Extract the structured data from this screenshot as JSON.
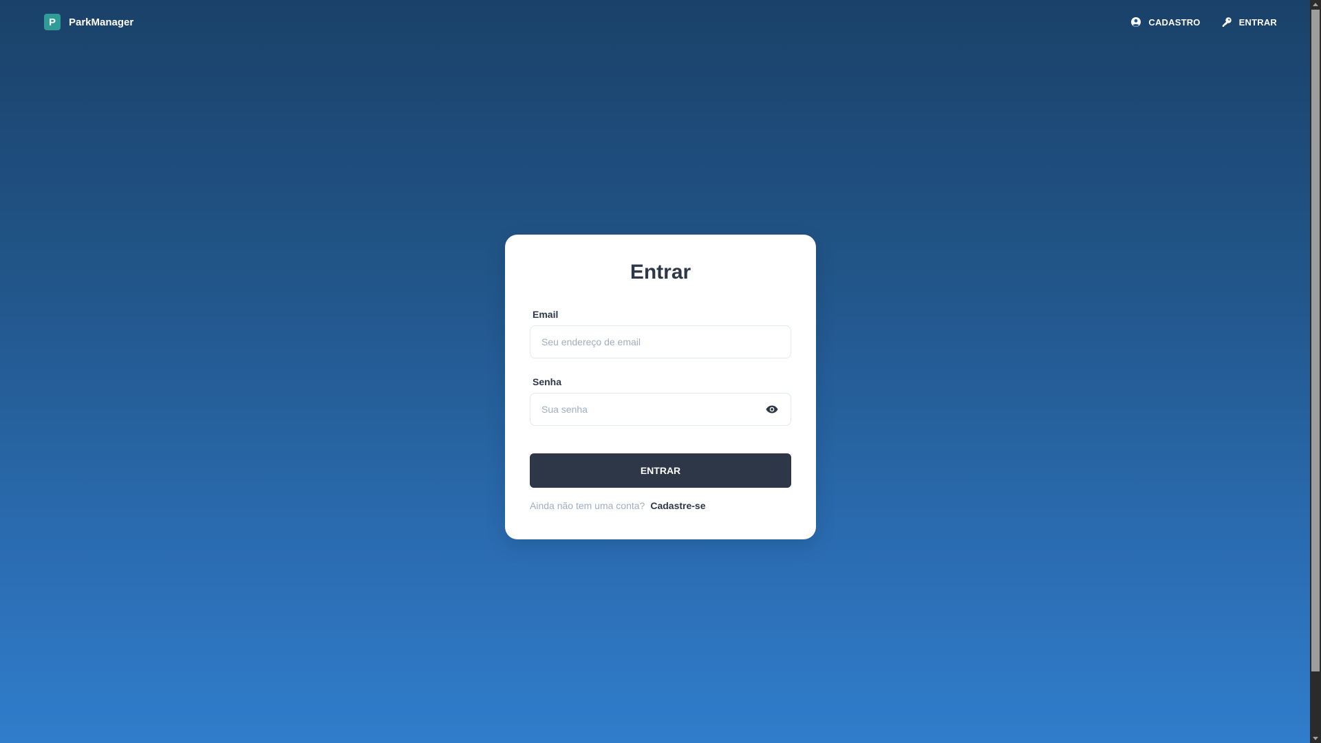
{
  "navbar": {
    "brand_logo_letter": "P",
    "brand_name": "ParkManager",
    "links": [
      {
        "label": "CADASTRO",
        "icon": "user-circle-icon"
      },
      {
        "label": "ENTRAR",
        "icon": "key-icon"
      }
    ]
  },
  "login": {
    "title": "Entrar",
    "email_label": "Email",
    "email_value": "",
    "email_placeholder": "Seu endereço de email",
    "password_label": "Senha",
    "password_value": "",
    "password_placeholder": "Sua senha",
    "show_password_icon": "eye-icon",
    "submit_label": "ENTRAR",
    "no_account_text": "Ainda não tem uma conta?",
    "signup_link": "Cadastre-se"
  },
  "colors": {
    "gradient_top": "#1a4169",
    "gradient_bottom": "#307dcb",
    "brand_accent": "#2f9c97",
    "primary_dark": "#2d3748",
    "muted_text": "#a0aec0"
  }
}
